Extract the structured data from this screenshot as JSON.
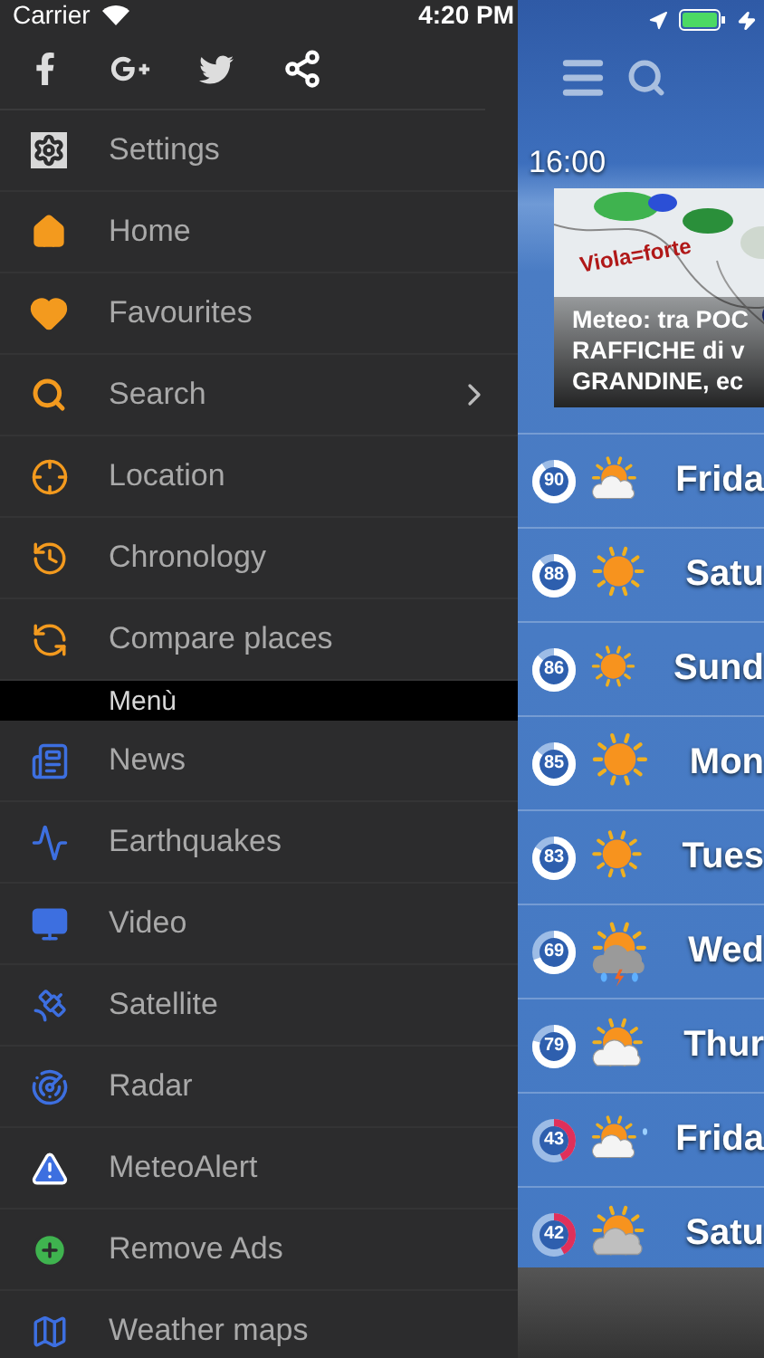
{
  "status_bar": {
    "carrier": "Carrier",
    "time": "4:20 PM"
  },
  "drawer": {
    "social": [
      {
        "kind": "facebook"
      },
      {
        "kind": "google-plus"
      },
      {
        "kind": "twitter"
      },
      {
        "kind": "share"
      }
    ],
    "items": [
      {
        "label": "Settings",
        "kind": "settings",
        "submenu": false
      },
      {
        "label": "Home",
        "kind": "home",
        "submenu": false
      },
      {
        "label": "Favourites",
        "kind": "heart",
        "submenu": false
      },
      {
        "label": "Search",
        "kind": "search",
        "submenu": true
      },
      {
        "label": "Location",
        "kind": "location",
        "submenu": false
      },
      {
        "label": "Chronology",
        "kind": "chronology",
        "submenu": false
      },
      {
        "label": "Compare places",
        "kind": "compare",
        "submenu": false
      }
    ],
    "section": "Menù",
    "section_items": [
      {
        "label": "News",
        "kind": "news"
      },
      {
        "label": "Earthquakes",
        "kind": "earthquake"
      },
      {
        "label": "Video",
        "kind": "video"
      },
      {
        "label": "Satellite",
        "kind": "satellite"
      },
      {
        "label": "Radar",
        "kind": "radar"
      },
      {
        "label": "MeteoAlert",
        "kind": "alert"
      },
      {
        "label": "Remove Ads",
        "kind": "plus"
      },
      {
        "label": "Weather maps",
        "kind": "map"
      }
    ]
  },
  "main": {
    "time": "16:00",
    "news": {
      "kind": "picture",
      "map_label": "Viola=forte",
      "caption_lines": [
        "Meteo: tra POC",
        "RAFFICHE di v",
        "GRANDINE, ec"
      ]
    },
    "forecast": [
      {
        "score": "90",
        "color": "#ffffff",
        "kind": "sun-cloud",
        "day": "Frida"
      },
      {
        "score": "88",
        "color": "#ffffff",
        "kind": "sun",
        "day": "Satu"
      },
      {
        "score": "86",
        "color": "#ffffff",
        "kind": "sun",
        "day": "Sund"
      },
      {
        "score": "85",
        "color": "#ffffff",
        "kind": "sun",
        "day": "Mon"
      },
      {
        "score": "83",
        "color": "#ffffff",
        "kind": "sun",
        "day": "Tues"
      },
      {
        "score": "69",
        "color": "#ffffff",
        "kind": "storm",
        "day": "Wed"
      },
      {
        "score": "79",
        "color": "#ffffff",
        "kind": "sun-cloud",
        "day": "Thur"
      },
      {
        "score": "43",
        "color": "#e0305a",
        "kind": "sun-cloud-drop",
        "day": "Frida"
      },
      {
        "score": "42",
        "color": "#e0305a",
        "kind": "sun-cloud-grey",
        "day": "Satu"
      }
    ]
  }
}
